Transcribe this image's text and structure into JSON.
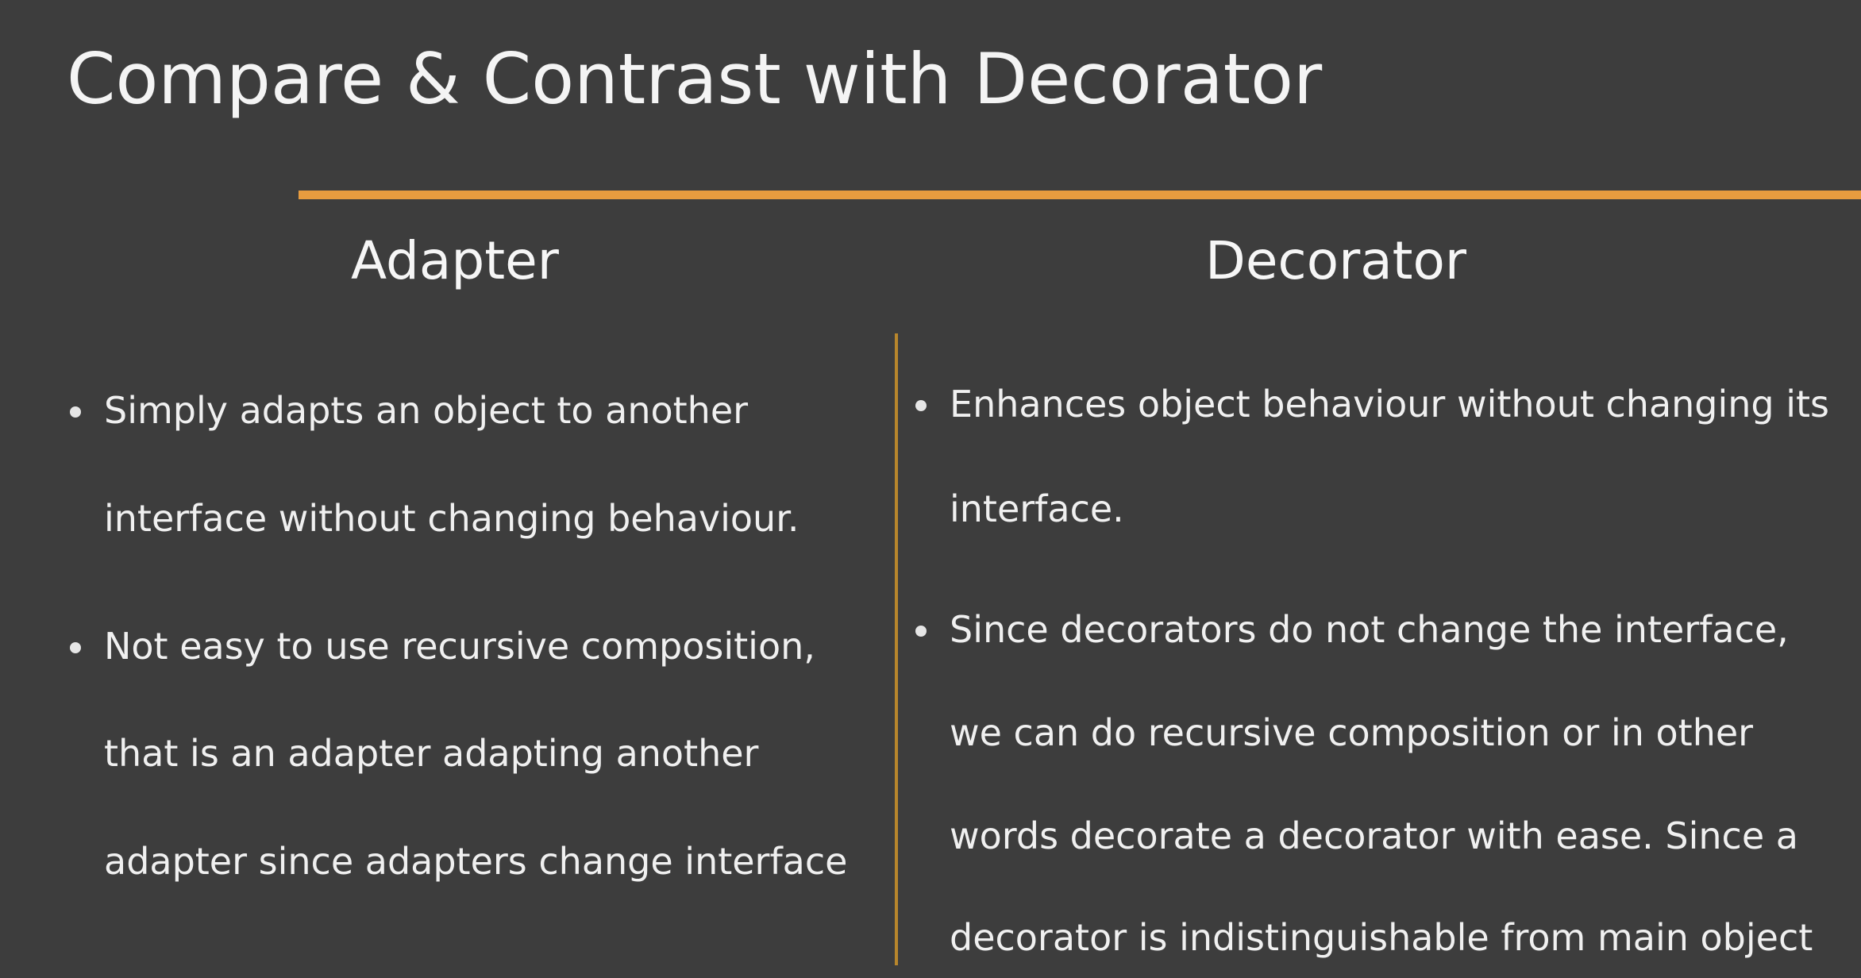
{
  "slide": {
    "title": "Compare & Contrast with Decorator",
    "accent_color": "#e89c3f",
    "divider_color": "#b8862c",
    "background_color": "#3d3d3d"
  },
  "columns": [
    {
      "heading": "Adapter",
      "bullets": [
        {
          "lines": [
            "Simply adapts an object to another",
            "interface without changing behaviour."
          ]
        },
        {
          "lines": [
            "Not easy to use recursive composition,",
            "that is an adapter adapting another",
            "adapter since adapters change interface"
          ]
        }
      ]
    },
    {
      "heading": "Decorator",
      "bullets": [
        {
          "lines": [
            "Enhances object behaviour without changing its",
            "interface."
          ]
        },
        {
          "lines": [
            "Since decorators do not change the interface,",
            "we can do recursive composition or in other",
            "words decorate a decorator with ease. Since a",
            "decorator is indistinguishable from main object"
          ]
        }
      ]
    }
  ]
}
